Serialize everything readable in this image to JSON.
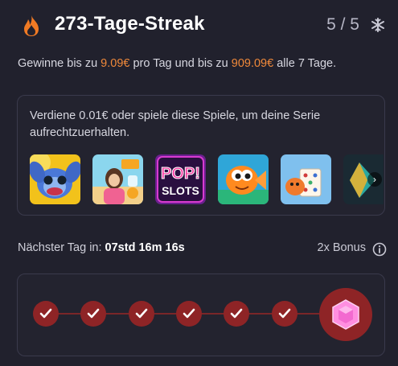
{
  "header": {
    "icon": "flame-icon",
    "title": "273-Tage-Streak",
    "count": "5 / 5",
    "freeze_icon": "snowflake-icon"
  },
  "description": {
    "part1": "Gewinne bis zu ",
    "daily_amount": "9.09€",
    "part2": " pro Tag und bis zu ",
    "weekly_amount": "909.09€",
    "part3": " alle 7 Tage."
  },
  "games_card": {
    "text": "Verdiene 0.01€ oder spiele diese Spiele, um deine Serie aufrechtzuerhalten.",
    "pop_slots_text": [
      "POP!",
      "SLOTS"
    ]
  },
  "countdown": {
    "label": "Nächster Tag in: ",
    "value": "07std 16m 16s",
    "bonus": "2x Bonus"
  },
  "progress": {
    "completed_days": 6,
    "total_days": 7
  },
  "colors": {
    "accent": "#f0893a",
    "streak_red": "#8e2426",
    "background": "#21212d"
  }
}
